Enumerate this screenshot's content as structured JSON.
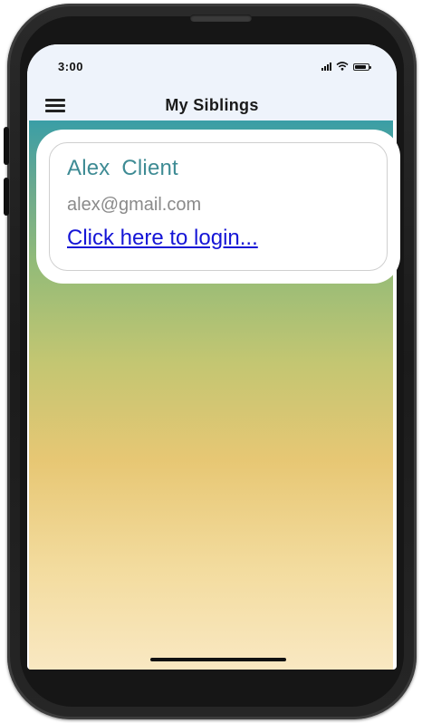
{
  "status_bar": {
    "time": "3:00",
    "icons": [
      "signal-icon",
      "wifi-icon",
      "battery-icon"
    ]
  },
  "header": {
    "title": "My Siblings",
    "menu_icon": "hamburger-menu-icon"
  },
  "sibling_card": {
    "name": "Alex  Client",
    "email": "alex@gmail.com",
    "login_link": "Click here to login..."
  },
  "colors": {
    "accent_name": "#3e8b94",
    "link": "#1515d6",
    "header_bg": "#eef3fb",
    "gradient_top": "#3a9ea6",
    "gradient_middle": "#e7c774",
    "gradient_bottom": "#f9e8c2"
  }
}
